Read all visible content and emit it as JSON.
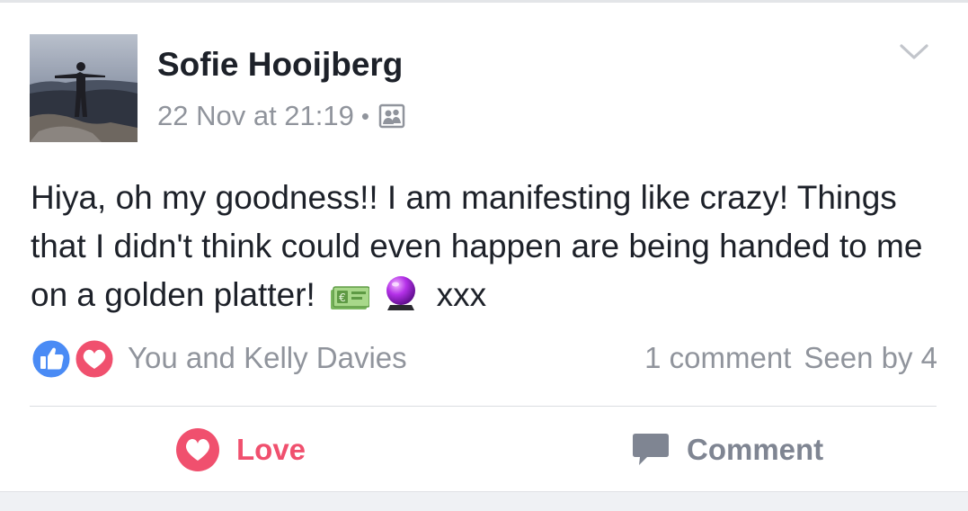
{
  "post": {
    "author": "Sofie Hooijberg",
    "timestamp": "22 Nov at 21:19",
    "separator": "•",
    "audience_icon": "friends-icon",
    "text_main": "Hiya, oh my goodness!! I am manifesting like crazy! Things that I didn't think could even happen are being handed to me on a golden platter!",
    "text_tail": "xxx",
    "emojis": [
      "euro-banknote-icon",
      "crystal-ball-icon"
    ]
  },
  "reactions": {
    "icons": [
      "like-reaction-icon",
      "love-reaction-icon"
    ],
    "summary": "You and Kelly Davies",
    "comments": "1 comment",
    "seen_by": "Seen by 4"
  },
  "actions": {
    "love_label": "Love",
    "comment_label": "Comment"
  },
  "colors": {
    "love": "#f0506e",
    "like": "#4a8bf5",
    "muted": "#90949c"
  }
}
